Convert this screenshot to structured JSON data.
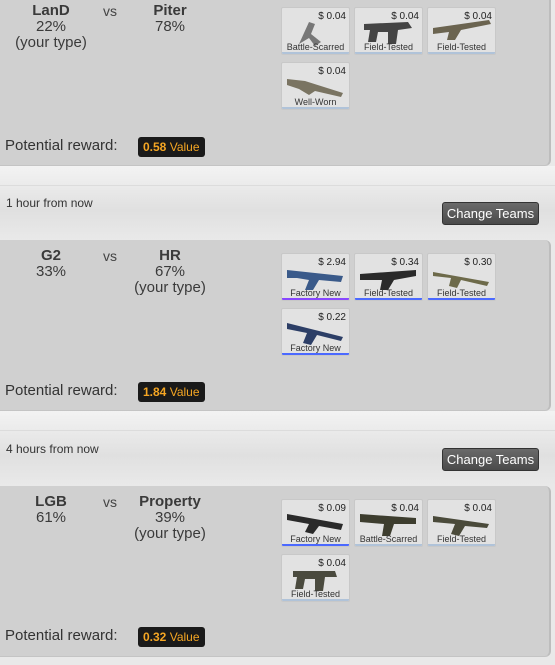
{
  "matches": [
    {
      "team_a": {
        "name": "LanD",
        "pct": "22%",
        "note": "(your type)"
      },
      "vs": "vs",
      "team_b": {
        "name": "Piter",
        "pct": "78%",
        "note": ""
      },
      "items": [
        {
          "price": "$ 0.04",
          "condition": "Battle-Scarred",
          "icon": "pistol-icon",
          "rarity_color": "#b0c3d9"
        },
        {
          "price": "$ 0.04",
          "condition": "Field-Tested",
          "icon": "smg-icon",
          "rarity_color": "#b0c3d9"
        },
        {
          "price": "$ 0.04",
          "condition": "Field-Tested",
          "icon": "shotgun-icon",
          "rarity_color": "#b0c3d9"
        },
        {
          "price": "$ 0.04",
          "condition": "Well-Worn",
          "icon": "rifle-icon",
          "rarity_color": "#b0c3d9"
        }
      ],
      "reward_label": "Potential reward:",
      "reward_value": "0.58",
      "reward_unit": "Value"
    },
    {
      "team_a": {
        "name": "G2",
        "pct": "33%",
        "note": ""
      },
      "vs": "vs",
      "team_b": {
        "name": "HR",
        "pct": "67%",
        "note": "(your type)"
      },
      "items": [
        {
          "price": "$ 2.94",
          "condition": "Factory New",
          "icon": "rifle-icon",
          "rarity_color": "#8847ff"
        },
        {
          "price": "$ 0.34",
          "condition": "Field-Tested",
          "icon": "rifle-icon",
          "rarity_color": "#4b69ff"
        },
        {
          "price": "$ 0.30",
          "condition": "Field-Tested",
          "icon": "sniper-icon",
          "rarity_color": "#4b69ff"
        },
        {
          "price": "$ 0.22",
          "condition": "Factory New",
          "icon": "rifle-icon",
          "rarity_color": "#4b69ff"
        }
      ],
      "reward_label": "Potential reward:",
      "reward_value": "1.84",
      "reward_unit": "Value"
    },
    {
      "team_a": {
        "name": "LGB",
        "pct": "61%",
        "note": ""
      },
      "vs": "vs",
      "team_b": {
        "name": "Property",
        "pct": "39%",
        "note": "(your type)"
      },
      "items": [
        {
          "price": "$ 0.09",
          "condition": "Factory New",
          "icon": "rifle-icon",
          "rarity_color": "#4b69ff"
        },
        {
          "price": "$ 0.04",
          "condition": "Battle-Scarred",
          "icon": "machinegun-icon",
          "rarity_color": "#b0c3d9"
        },
        {
          "price": "$ 0.04",
          "condition": "Field-Tested",
          "icon": "rifle-icon",
          "rarity_color": "#b0c3d9"
        },
        {
          "price": "$ 0.04",
          "condition": "Field-Tested",
          "icon": "smg-icon",
          "rarity_color": "#b0c3d9"
        }
      ],
      "reward_label": "Potential reward:",
      "reward_value": "0.32",
      "reward_unit": "Value"
    }
  ],
  "separators": [
    {
      "time": "1 hour from now",
      "button": "Change Teams"
    },
    {
      "time": "4 hours from now",
      "button": "Change Teams"
    }
  ]
}
